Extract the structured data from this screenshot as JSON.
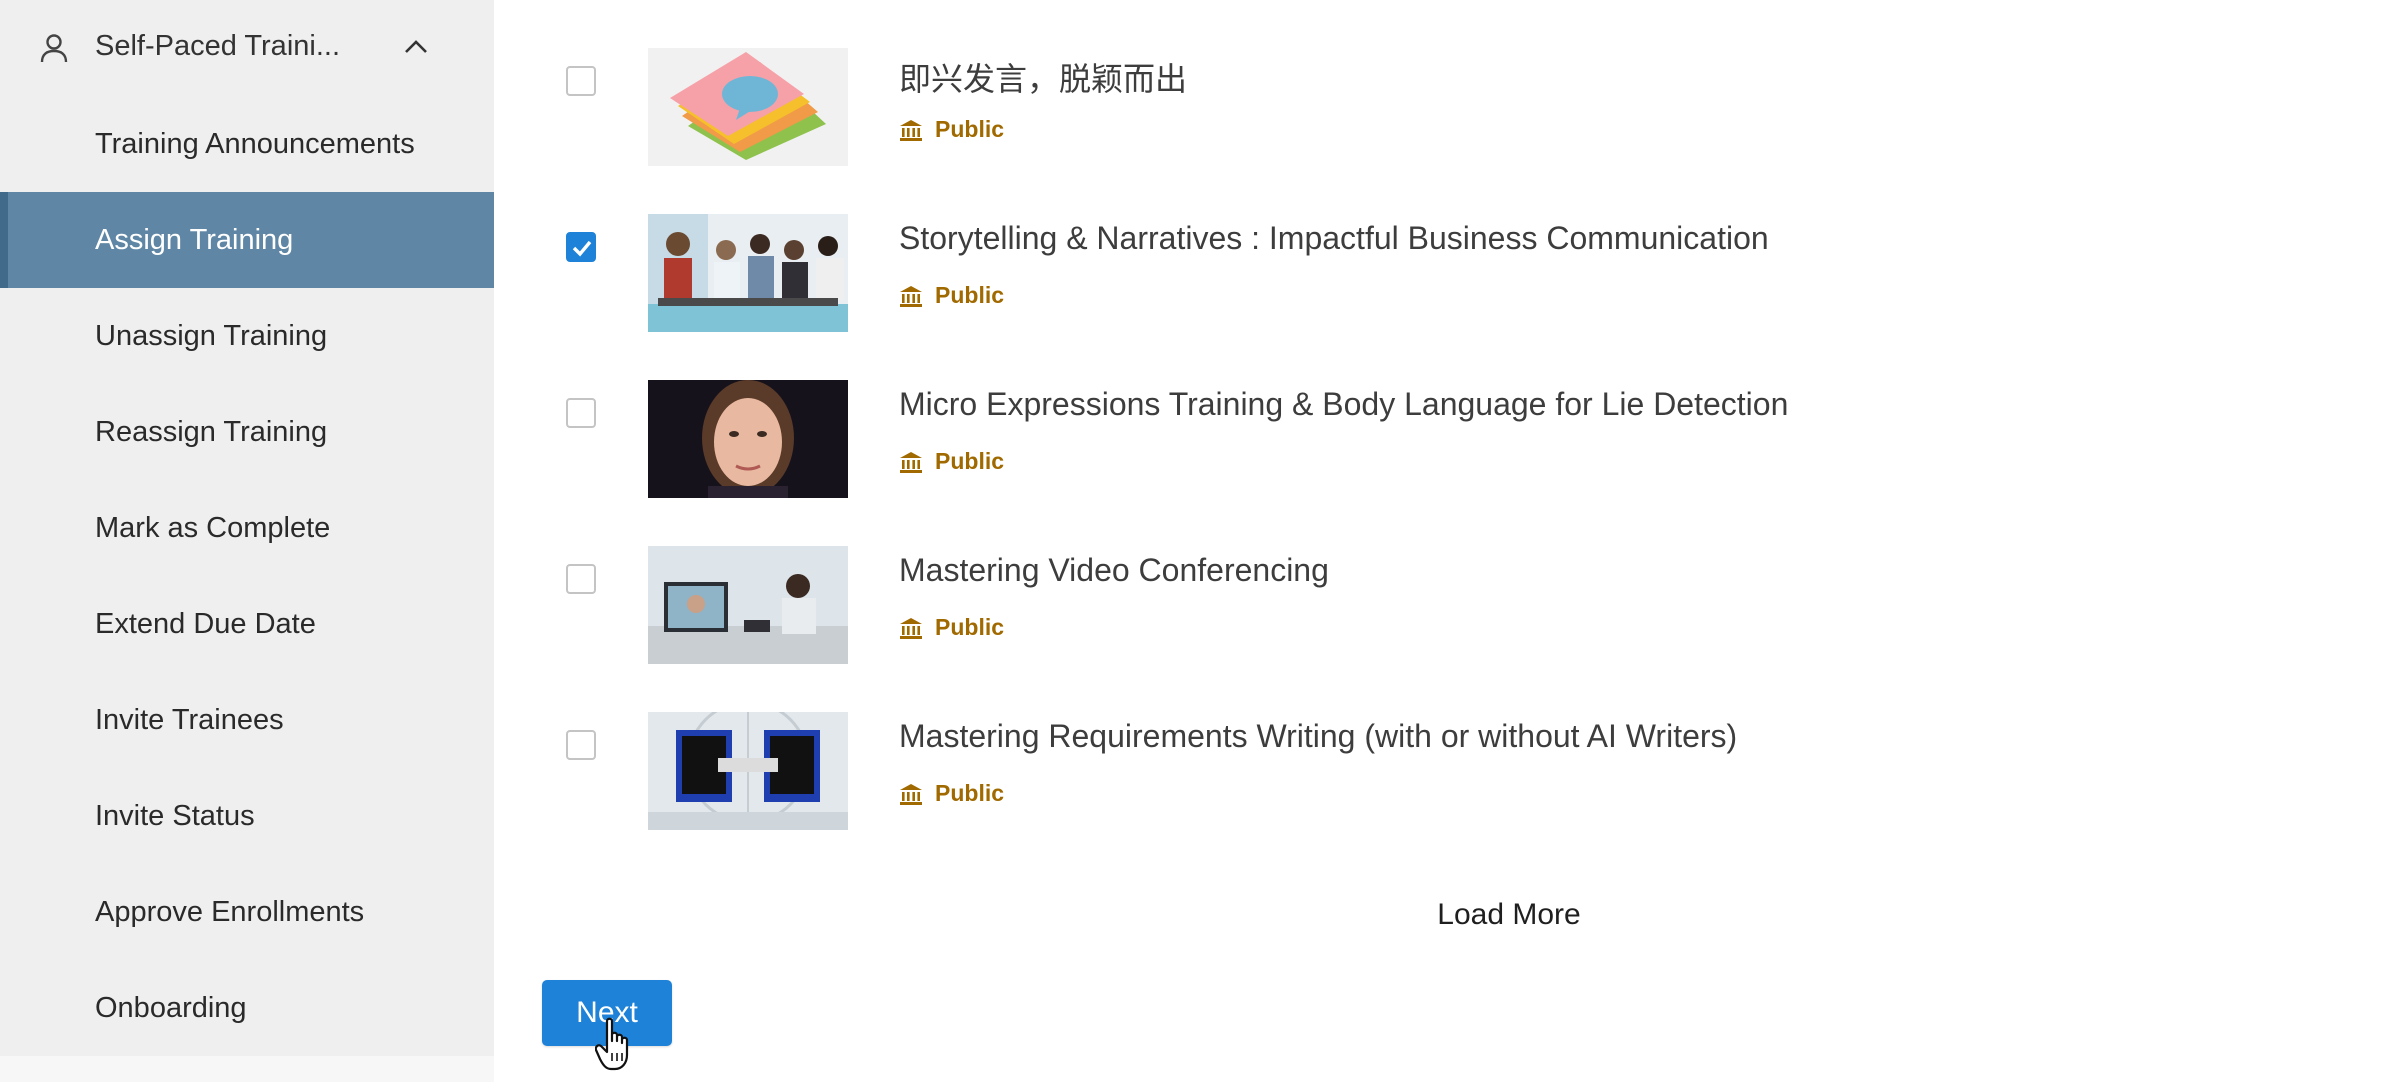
{
  "sidebar": {
    "section_title": "Self-Paced Traini...",
    "items": [
      {
        "label": "Training Announcements",
        "active": false
      },
      {
        "label": "Assign Training",
        "active": true
      },
      {
        "label": "Unassign Training",
        "active": false
      },
      {
        "label": "Reassign Training",
        "active": false
      },
      {
        "label": "Mark as Complete",
        "active": false
      },
      {
        "label": "Extend Due Date",
        "active": false
      },
      {
        "label": "Invite Trainees",
        "active": false
      },
      {
        "label": "Invite Status",
        "active": false
      },
      {
        "label": "Approve Enrollments",
        "active": false
      },
      {
        "label": "Onboarding",
        "active": false
      }
    ],
    "active_color": "#5f87a5"
  },
  "courses": [
    {
      "title": "即兴发言，脱颖而出",
      "visibility": "Public",
      "checked": false,
      "thumb": "sticky-notes-speech-bubble"
    },
    {
      "title": "Storytelling & Narratives : Impactful Business Communication",
      "visibility": "Public",
      "checked": true,
      "thumb": "business-team-photo"
    },
    {
      "title": "Micro Expressions Training & Body Language for Lie Detection",
      "visibility": "Public",
      "checked": false,
      "thumb": "woman-face-portrait"
    },
    {
      "title": "Mastering Video Conferencing",
      "visibility": "Public",
      "checked": false,
      "thumb": "video-call-office"
    },
    {
      "title": "Mastering Requirements Writing (with or without AI Writers)",
      "visibility": "Public",
      "checked": false,
      "thumb": "handshake-through-monitors"
    }
  ],
  "load_more_label": "Load More",
  "next_label": "Next",
  "colors": {
    "accent": "#1e82d8",
    "badge": "#a06a00"
  }
}
